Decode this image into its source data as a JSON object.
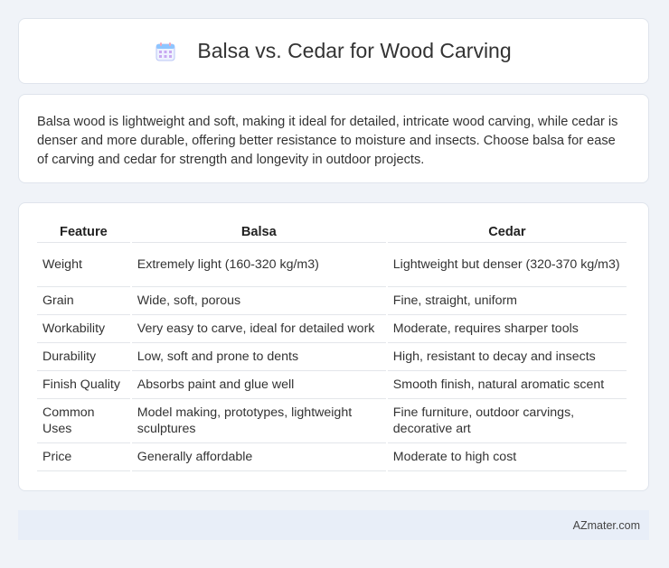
{
  "header": {
    "title": "Balsa vs. Cedar for Wood Carving",
    "icon": "calendar-icon",
    "icon_colors": [
      "#f4a7b9",
      "#8ec5ff",
      "#c8a8f0"
    ]
  },
  "summary": {
    "text": "Balsa wood is lightweight and soft, making it ideal for detailed, intricate wood carving, while cedar is denser and more durable, offering better resistance to moisture and insects. Choose balsa for ease of carving and cedar for strength and longevity in outdoor projects."
  },
  "table": {
    "headers": [
      "Feature",
      "Balsa",
      "Cedar"
    ],
    "rows": [
      [
        "Weight",
        "Extremely light (160-320 kg/m3)",
        "Lightweight but denser (320-370 kg/m3)"
      ],
      [
        "Grain",
        "Wide, soft, porous",
        "Fine, straight, uniform"
      ],
      [
        "Workability",
        "Very easy to carve, ideal for detailed work",
        "Moderate, requires sharper tools"
      ],
      [
        "Durability",
        "Low, soft and prone to dents",
        "High, resistant to decay and insects"
      ],
      [
        "Finish Quality",
        "Absorbs paint and glue well",
        "Smooth finish, natural aromatic scent"
      ],
      [
        "Common Uses",
        "Model making, prototypes, lightweight sculptures",
        "Fine furniture, outdoor carvings, decorative art"
      ],
      [
        "Price",
        "Generally affordable",
        "Moderate to high cost"
      ]
    ]
  },
  "footer": {
    "text": "AZmater.com"
  }
}
